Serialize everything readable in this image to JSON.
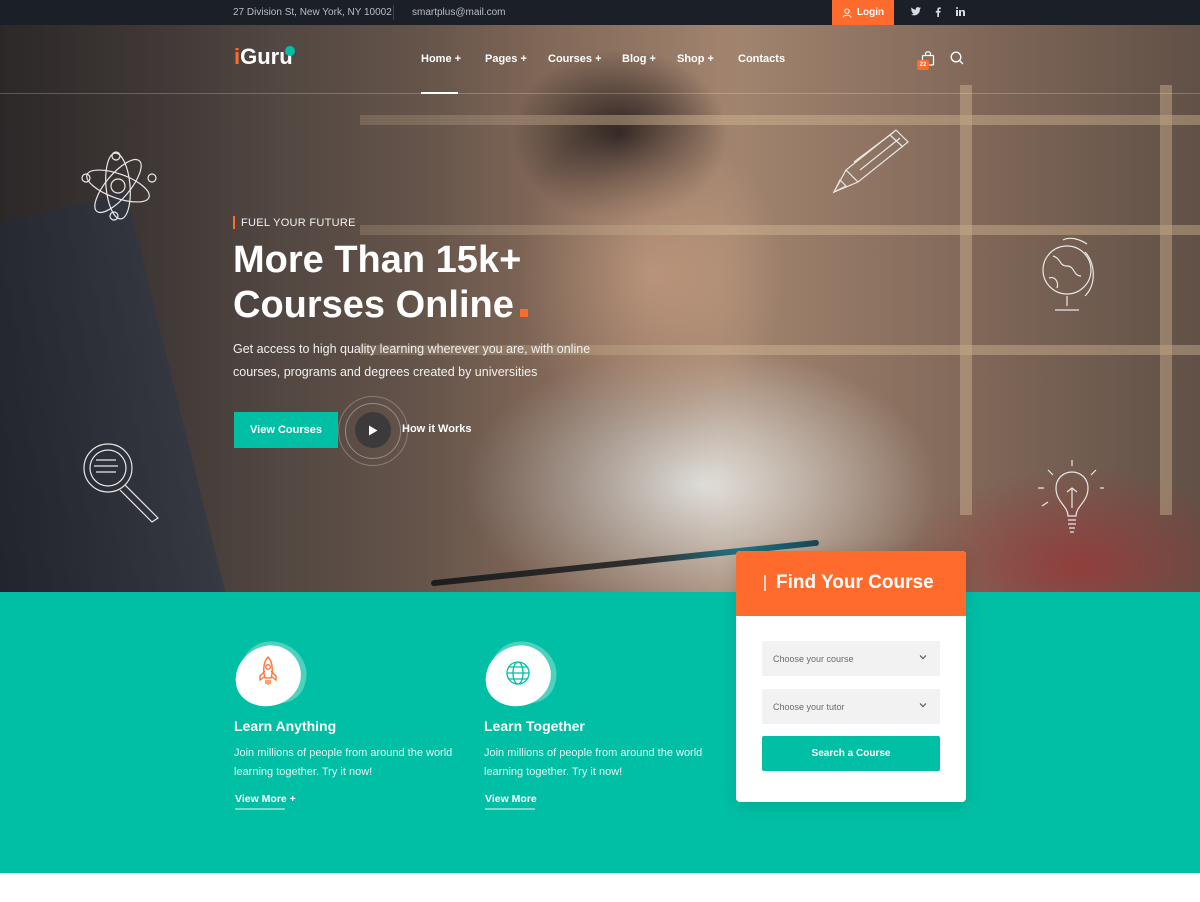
{
  "topbar": {
    "address": "27 Division St, New York, NY 10002",
    "email": "smartplus@mail.com",
    "login_label": "Login",
    "social": [
      {
        "icon": "twitter-icon",
        "glyph": "𝕥"
      },
      {
        "icon": "facebook-icon",
        "glyph": "f"
      },
      {
        "icon": "linkedin-icon",
        "glyph": "in"
      }
    ]
  },
  "header": {
    "logo": {
      "first": "i",
      "rest": "Guru"
    },
    "nav": [
      {
        "label": "Home +",
        "active": true
      },
      {
        "label": "Pages +"
      },
      {
        "label": "Courses +"
      },
      {
        "label": "Blog +"
      },
      {
        "label": "Shop +"
      },
      {
        "label": "Contacts"
      }
    ],
    "cart_count": "22"
  },
  "hero": {
    "eyebrow": "FUEL YOUR FUTURE",
    "headline_line1": "More Than 15k+",
    "headline_line2": "Courses Online",
    "description": "Get access to high quality learning wherever you are, with online courses, programs and degrees created by universities",
    "primary_button": "View Courses",
    "video_label": "How it Works"
  },
  "features": [
    {
      "icon": "rocket-icon",
      "title": "Learn Anything",
      "description": "Join millions of people from around the world learning together. Try it now!",
      "link": "View More +"
    },
    {
      "icon": "globe-icon",
      "title": "Learn Together",
      "description": "Join millions of people from around the world learning together. Try it now!",
      "link": "View More"
    }
  ],
  "course_finder": {
    "title": "Find Your Course",
    "course_placeholder": "Choose your course",
    "tutor_placeholder": "Choose your tutor",
    "button": "Search a Course"
  },
  "colors": {
    "accent_orange": "#ff6b2c",
    "accent_teal": "#00bfa5",
    "topbar_bg": "#1b1f27"
  }
}
